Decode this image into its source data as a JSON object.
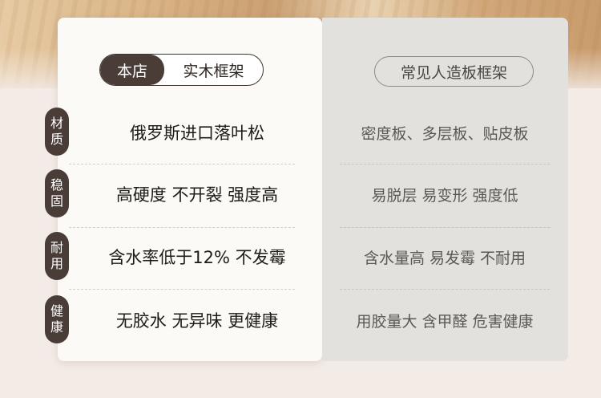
{
  "header": {
    "our_store": "本店",
    "our_frame": "实木框架",
    "common_frame": "常见人造板框架"
  },
  "rows": [
    {
      "category_top": "材",
      "category_bottom": "质",
      "ours": "俄罗斯进口落叶松",
      "common": "密度板、多层板、贴皮板"
    },
    {
      "category_top": "稳",
      "category_bottom": "固",
      "ours": "高硬度 不开裂 强度高",
      "common": "易脱层 易变形 强度低"
    },
    {
      "category_top": "耐",
      "category_bottom": "用",
      "ours": "含水率低于12% 不发霉",
      "common": "含水量高 易发霉 不耐用"
    },
    {
      "category_top": "健",
      "category_bottom": "康",
      "ours": "无胶水 无异味 更健康",
      "common": "用胶量大 含甲醛 危害健康"
    }
  ],
  "colors": {
    "accent_dark": "#4a3d38",
    "panel_light": "#fbfaf7",
    "panel_gray": "#e3e1dd"
  }
}
